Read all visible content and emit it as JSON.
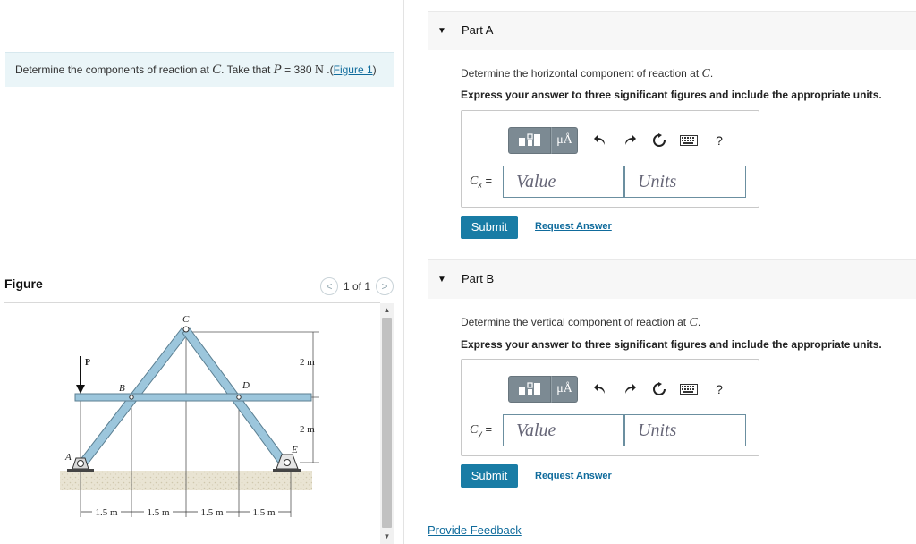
{
  "problem": {
    "text_prefix": "Determine the components of reaction at ",
    "point": "C",
    "text_mid": ". Take that ",
    "var": "P",
    "equals": " = 380 ",
    "unit": "N",
    "link_prefix": " .(",
    "link": "Figure 1",
    "link_suffix": ")"
  },
  "figure": {
    "title": "Figure",
    "pager_prev": "<",
    "pager_text": "1 of 1",
    "pager_next": ">",
    "labels": {
      "C": "C",
      "B": "B",
      "D": "D",
      "P": "P",
      "A": "A",
      "E": "E",
      "h_upper": "2 m",
      "h_lower": "2 m",
      "d1": "1.5 m",
      "d2": "1.5 m",
      "d3": "1.5 m",
      "d4": "1.5 m"
    }
  },
  "parts": [
    {
      "title": "Part A",
      "question_prefix": "Determine the horizontal component of reaction at ",
      "question_point": "C",
      "question_suffix": ".",
      "instruction": "Express your answer to three significant figures and include the appropriate units.",
      "var_symbol": "C",
      "var_sub": "x",
      "equals": " =",
      "value_placeholder": "Value",
      "units_placeholder": "Units",
      "submit": "Submit",
      "request": "Request Answer"
    },
    {
      "title": "Part B",
      "question_prefix": "Determine the vertical component of reaction at ",
      "question_point": "C",
      "question_suffix": ".",
      "instruction": "Express your answer to three significant figures and include the appropriate units.",
      "var_symbol": "C",
      "var_sub": "y",
      "equals": " =",
      "value_placeholder": "Value",
      "units_placeholder": "Units",
      "submit": "Submit",
      "request": "Request Answer"
    }
  ],
  "toolbar": {
    "mu_label": "μÅ",
    "help": "?",
    "icons": [
      "templates-icon",
      "units-mu-icon",
      "undo-icon",
      "redo-icon",
      "reset-icon",
      "keyboard-icon",
      "help-icon"
    ]
  },
  "feedback": "Provide Feedback",
  "colors": {
    "accent": "#197ca5",
    "link": "#0f6b9c",
    "problem_bg": "#eaf5f8",
    "member": "#9cc6dc",
    "toolbar_btn": "#7c8a93"
  }
}
